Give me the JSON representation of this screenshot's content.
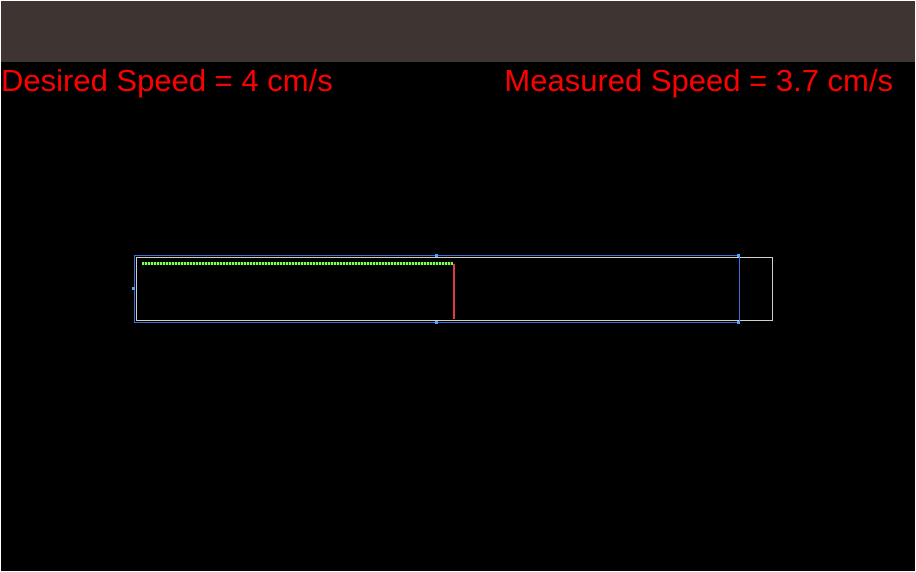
{
  "speeds": {
    "desired": "Desired Speed = 4 cm/s",
    "measured": "Measured Speed = 3.7 cm/s"
  },
  "progress": {
    "fraction": 0.49
  },
  "colors": {
    "label": "#ff0000",
    "toolbar": "#3e3432",
    "trail": "#7cff52",
    "pen": "#e03a3a",
    "selection": "#3a6fd8"
  }
}
